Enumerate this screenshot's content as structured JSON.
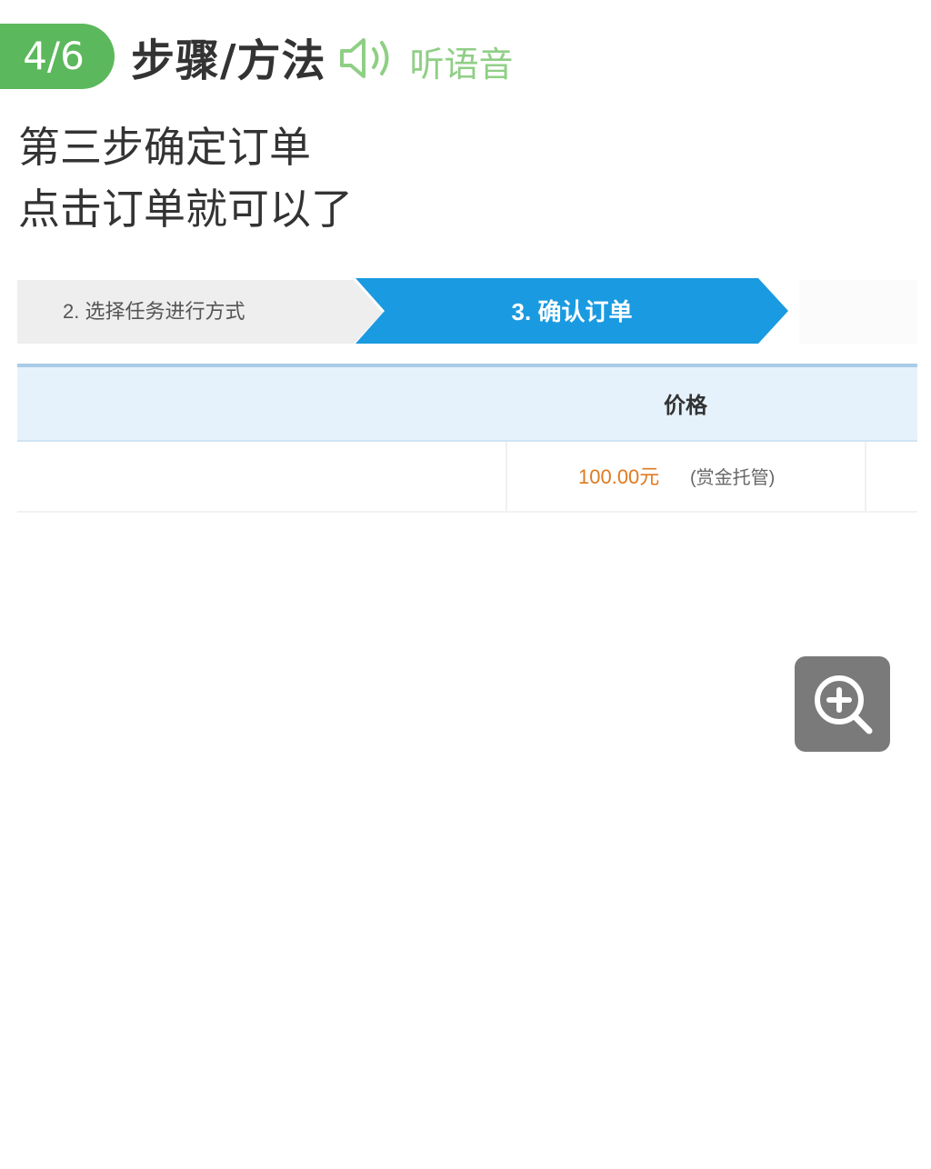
{
  "step": {
    "counter": "4/6",
    "section_title": "步骤/方法",
    "listen_label": "听语音",
    "listen_icon": "speaker-icon",
    "badge_color": "#5cb85c",
    "listen_color": "#8fcf85"
  },
  "instructions": {
    "line1": "第三步确定订单",
    "line2": "点击订单就可以了"
  },
  "screenshot": {
    "tab_prev_label": "2. 选择任务进行方式",
    "tab_active_label": "3. 确认订单",
    "active_tab_color": "#1a9ae0",
    "table_header": "价格",
    "price_value": "100.00元",
    "price_note": "(赏金托管)",
    "price_color": "#e07a20"
  },
  "zoom": {
    "icon": "zoom-in-icon"
  }
}
